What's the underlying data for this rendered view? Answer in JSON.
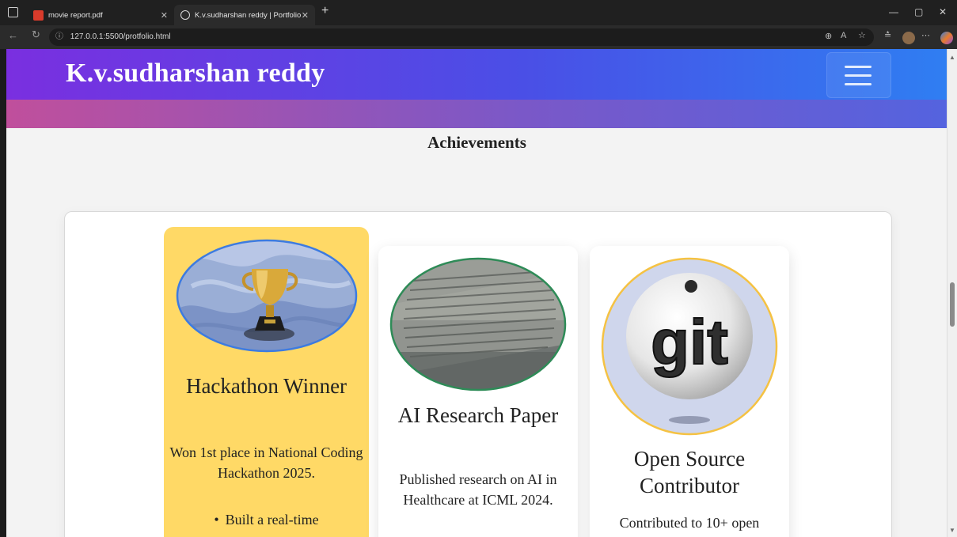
{
  "browser": {
    "tabs": [
      {
        "label": "movie report.pdf"
      },
      {
        "label": "K.v.sudharshan reddy | Portfolio"
      }
    ],
    "url": "127.0.0.1:5500/protfolio.html"
  },
  "header": {
    "title": "K.v.sudharshan reddy"
  },
  "section": {
    "title": "Achievements"
  },
  "cards": [
    {
      "title": "Hackathon Winner",
      "description": "Won 1st place in National Coding Hackathon 2025.",
      "bullets": [
        "Built a real-time"
      ],
      "icon": "trophy-icon",
      "background": "#ffd966",
      "frame_color": "#3d7be0"
    },
    {
      "title": "AI Research Paper",
      "description": "Published research on AI in Healthcare at ICML 2024.",
      "icon": "book-page-icon",
      "frame_color": "#2e8b57"
    },
    {
      "title": "Open Source Contributor",
      "description": "Contributed to 10+ open",
      "icon": "git-logo-icon",
      "logo_text": "git",
      "frame_color": "#f5c243"
    }
  ]
}
